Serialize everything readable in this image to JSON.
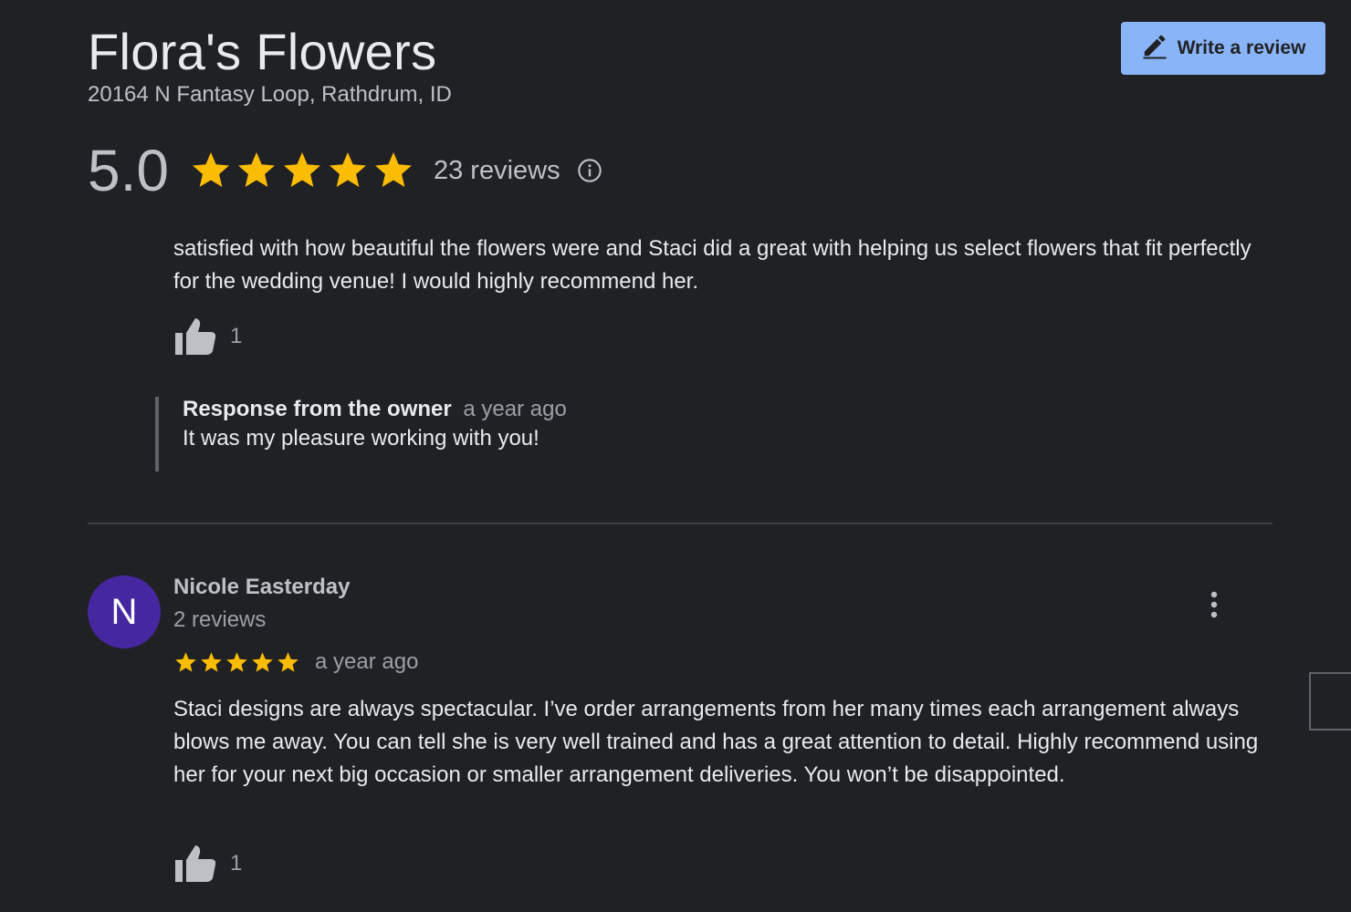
{
  "place": {
    "name": "Flora's Flowers",
    "address": "20164 N Fantasy Loop, Rathdrum, ID"
  },
  "actions": {
    "write_review_label": "Write a review",
    "icon": "pencil-icon"
  },
  "summary": {
    "rating": "5.0",
    "stars": 5,
    "reviews_label": "23 reviews",
    "info_icon": "info-icon"
  },
  "colors": {
    "star": "#fbbc04",
    "accent": "#8ab4f8",
    "avatar": "#4527a0",
    "background": "#202124"
  },
  "review1": {
    "text": "satisfied with how beautiful  the flowers were and Staci did a great with helping us select flowers that fit perfectly for the wedding venue! I would highly recommend her.",
    "likes": "1",
    "owner_response": {
      "label": "Response from the owner",
      "time": "a year ago",
      "text": "It was my pleasure working with you!"
    }
  },
  "review2": {
    "avatar_letter": "N",
    "reviewer": "Nicole Easterday",
    "reviewer_reviews": "2 reviews",
    "stars": 5,
    "time": "a year ago",
    "text": "Staci designs are always spectacular. I’ve order arrangements from her many times each arrangement always blows me away. You can tell she is very well trained and has a great attention to detail. Highly recommend using her for your next big occasion or smaller arrangement deliveries. You won’t be disappointed.",
    "likes": "1"
  }
}
